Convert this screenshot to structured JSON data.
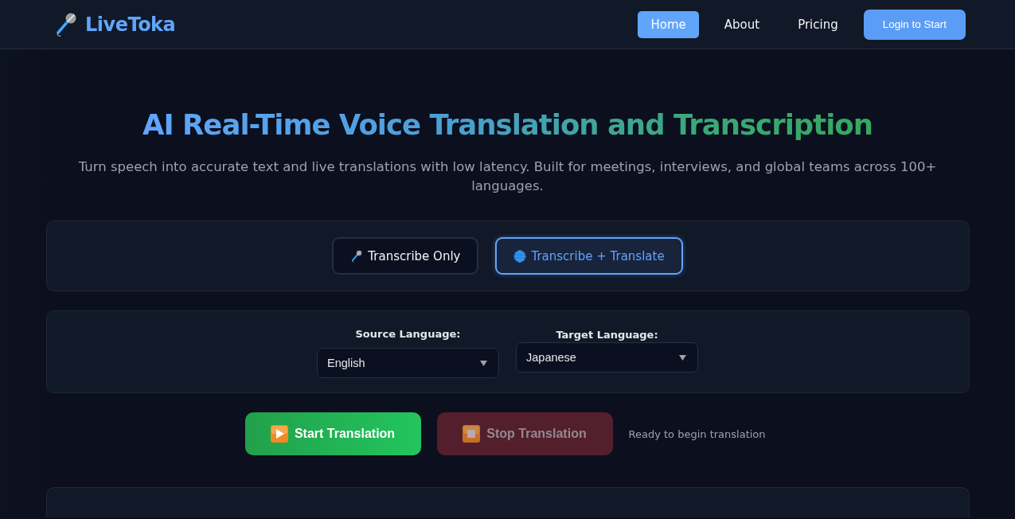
{
  "header": {
    "logo": "LiveToka",
    "nav": [
      {
        "label": "Home",
        "selected": true
      },
      {
        "label": "About",
        "selected": false
      },
      {
        "label": "Pricing",
        "selected": false
      }
    ],
    "login_button": "Login to Start"
  },
  "hero": {
    "title": "AI Real-Time Voice Translation and Transcription",
    "subtitle": "Turn speech into accurate text and live translations with low latency. Built for meetings, interviews, and global teams across 100+ languages."
  },
  "modes": [
    {
      "kind": "transcribe",
      "label": "Transcribe Only",
      "selected": false
    },
    {
      "kind": "translate",
      "label": "Transcribe + Translate",
      "selected": true
    }
  ],
  "languages": [
    {
      "label": "Source Language:",
      "value": "English"
    },
    {
      "label": "Target Language:",
      "value": "Japanese"
    }
  ],
  "actions": [
    {
      "kind": "start",
      "label": "Start Translation",
      "disabled": false
    },
    {
      "kind": "stop",
      "label": "Stop Translation",
      "disabled": true
    }
  ],
  "status": "Ready to begin translation"
}
